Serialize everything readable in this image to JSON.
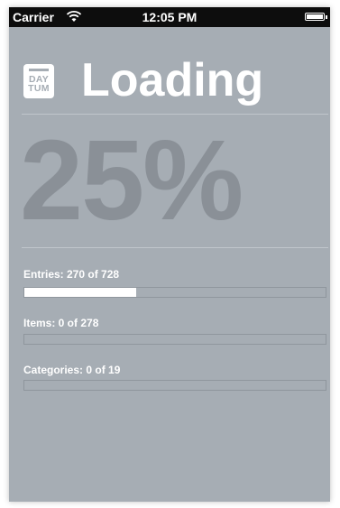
{
  "status_bar": {
    "carrier": "Carrier",
    "time": "12:05 PM",
    "wifi_icon": "wifi-icon",
    "battery_icon": "battery-icon"
  },
  "header": {
    "logo_line1": "DAY",
    "logo_line2": "TUM",
    "title": "Loading"
  },
  "overall_percent": "25%",
  "progress": [
    {
      "label": "Entries: 270 of 728",
      "fraction": 0.371
    },
    {
      "label": "Items: 0 of 278",
      "fraction": 0
    },
    {
      "label": "Categories: 0 of 19",
      "fraction": 0
    }
  ],
  "colors": {
    "background": "#a6adb4",
    "percent_text": "#8a9097",
    "bar_fill": "#ffffff"
  }
}
